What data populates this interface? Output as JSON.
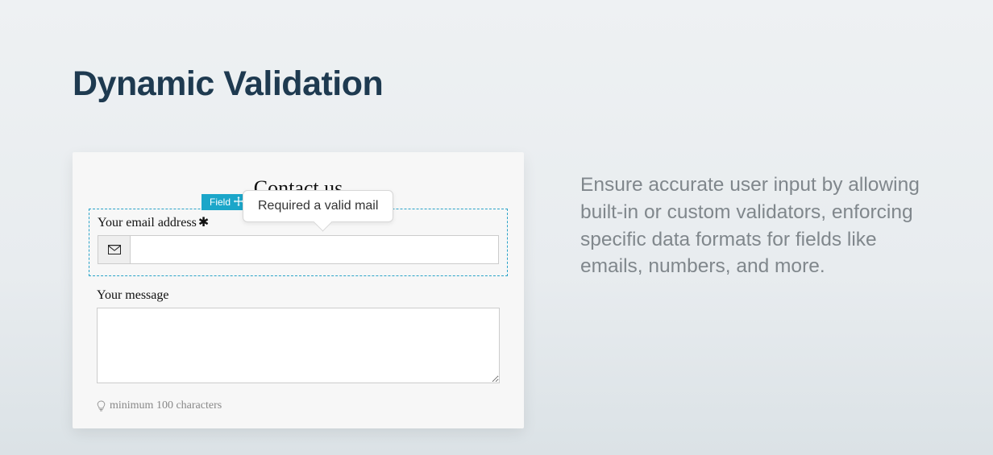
{
  "heading": "Dynamic Validation",
  "description": "Ensure accurate user input by allowing built-in or custom validators, enforcing specific data formats for fields like emails, numbers, and more.",
  "card": {
    "title": "Contact us",
    "field_tag": "Field",
    "tooltip": "Required a valid mail",
    "email": {
      "label": "Your email address",
      "required_glyph": "✱",
      "icon": "envelope-icon",
      "value": ""
    },
    "message": {
      "label": "Your message",
      "value": ""
    },
    "hint": "minimum 100 characters"
  }
}
